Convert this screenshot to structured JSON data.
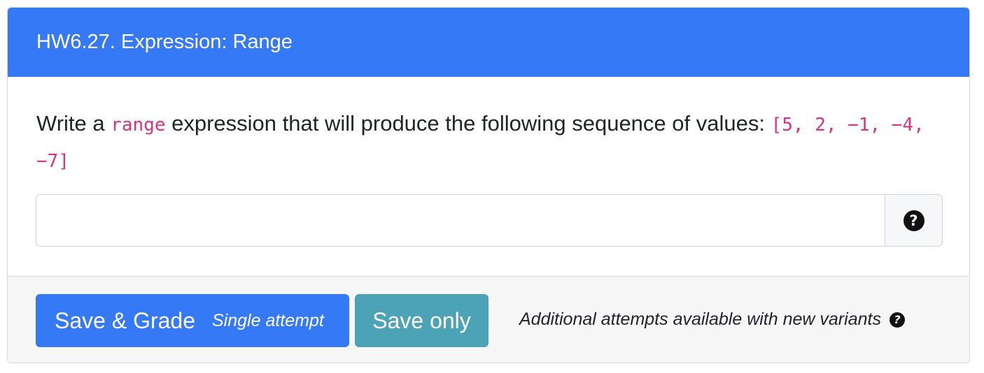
{
  "question": {
    "title": "HW6.27. Expression: Range",
    "prompt_before": "Write a ",
    "prompt_code_keyword": "range",
    "prompt_after": " expression that will produce the following sequence of values: ",
    "prompt_sequence": "[5, 2, −1, −4, −7]"
  },
  "answer": {
    "value": "",
    "placeholder": "",
    "help_icon": "question-circle-icon"
  },
  "footer": {
    "grade_button_label": "Save & Grade",
    "grade_button_sublabel": "Single attempt",
    "save_button_label": "Save only",
    "attempts_note": "Additional attempts available with new variants",
    "attempts_help_icon": "question-circle-icon"
  },
  "colors": {
    "header_bg": "#3679f6",
    "grade_button": "#3679f6",
    "save_button": "#4ba3b5",
    "code_text": "#d63384"
  }
}
